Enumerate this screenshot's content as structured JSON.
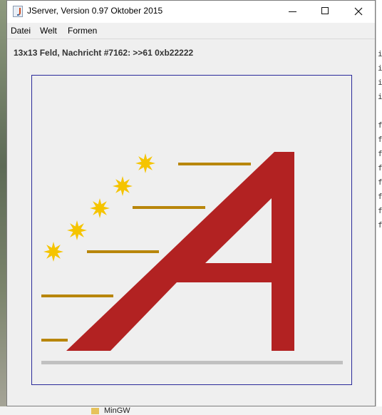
{
  "window": {
    "title": "JServer, Version 0.97 Oktober 2015",
    "controls": [
      "minimize",
      "maximize",
      "close"
    ]
  },
  "menu": {
    "items": [
      {
        "label": "Datei"
      },
      {
        "label": "Welt"
      },
      {
        "label": "Formen"
      }
    ]
  },
  "status": {
    "text": "13x13 Feld, Nachricht #7162: >>61 0xb22222"
  },
  "board": {
    "logo": "letter A with speed lines and stars",
    "colors": {
      "letter": "#b22222",
      "lines": "#b8860b",
      "stars": "#f5c400",
      "ground": "#c0c0c0",
      "frame": "#2a2a9a",
      "background": "#efefef"
    }
  },
  "background_window": {
    "code_lines": [
      "i",
      "i",
      "i",
      "i",
      "f",
      "f",
      "f",
      "f",
      "f",
      "f",
      "f",
      "f"
    ],
    "folder_label": "MinGW"
  }
}
